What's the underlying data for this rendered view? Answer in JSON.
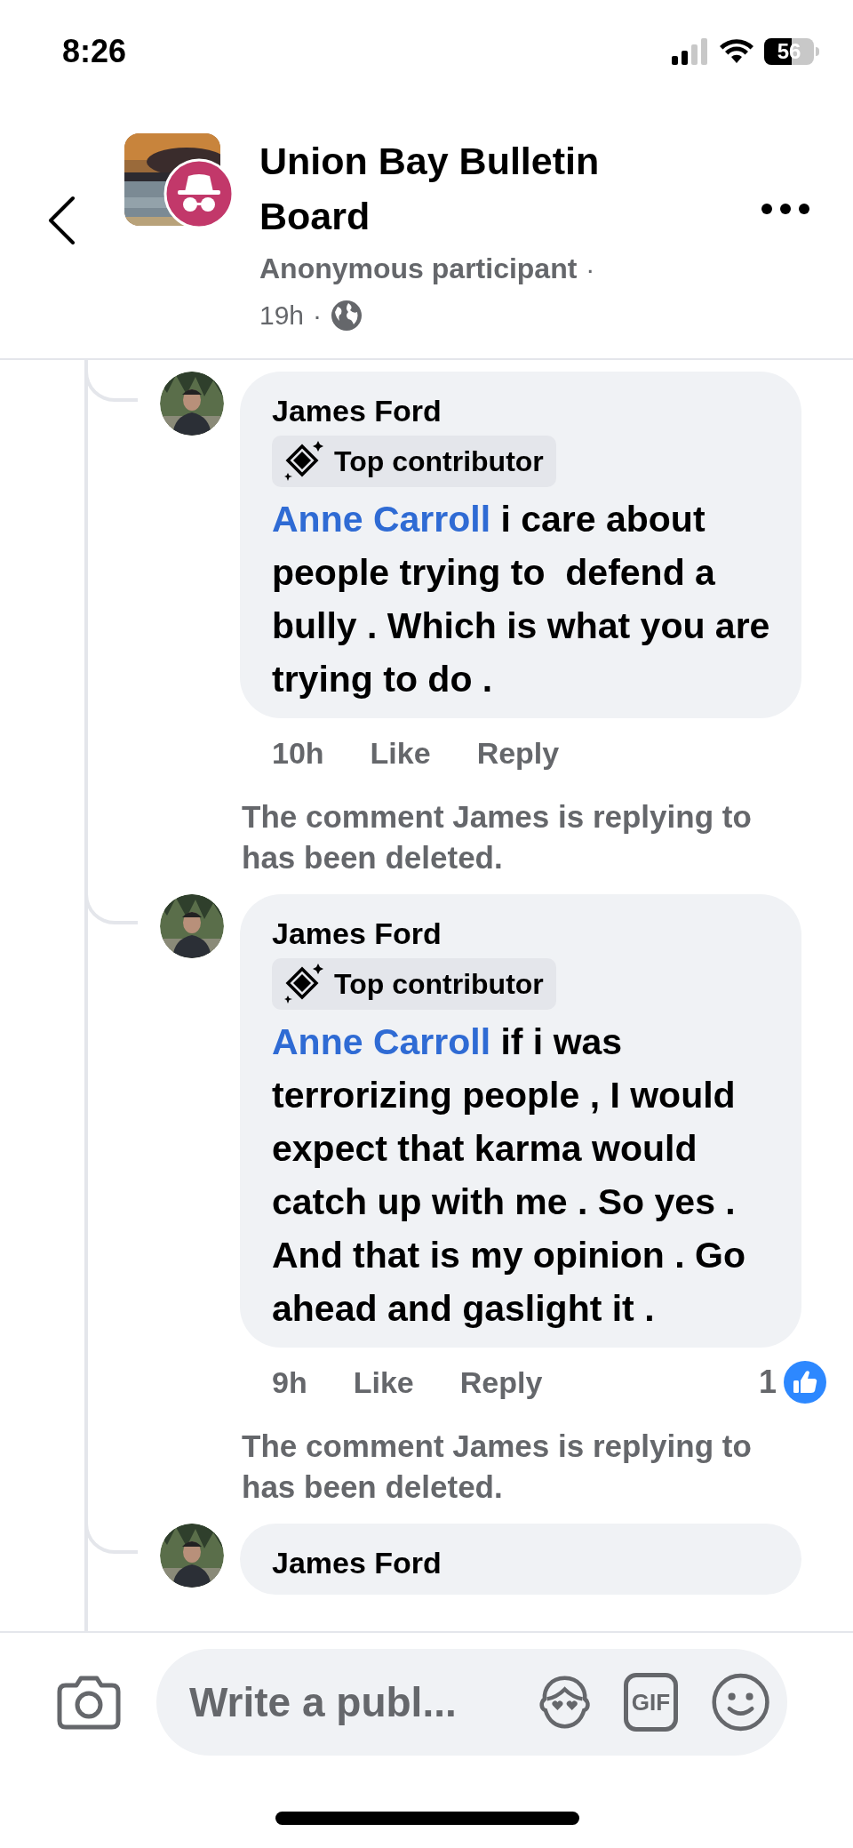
{
  "status_bar": {
    "time": "8:26",
    "battery": "56"
  },
  "header": {
    "title": "Union Bay Bulletin Board",
    "author": "Anonymous participant",
    "dots": [
      "·",
      "·"
    ],
    "time": "19h"
  },
  "thread": [
    {
      "kind": "comment",
      "name": "James Ford",
      "badge": "Top contributor",
      "mention": "Anne Carroll",
      "text": "i care about people trying to  defend a bully . Which is what you are trying to do .",
      "time": "10h",
      "actions": [
        "Like",
        "Reply"
      ]
    },
    {
      "kind": "notice",
      "text": "The comment James is replying to has been deleted."
    },
    {
      "kind": "comment",
      "name": "James Ford",
      "badge": "Top contributor",
      "mention": "Anne Carroll",
      "text": "if i was terrorizing people , I would expect that karma would catch up with me . So yes . And that is my opinion . Go ahead and gaslight it .",
      "time": "9h",
      "actions": [
        "Like",
        "Reply"
      ],
      "reactions": "1"
    },
    {
      "kind": "notice",
      "text": "The comment James is replying to has been deleted."
    },
    {
      "kind": "comment",
      "name": "James Ford"
    }
  ],
  "composer": {
    "placeholder": "Write a publ...",
    "gif": "GIF"
  }
}
